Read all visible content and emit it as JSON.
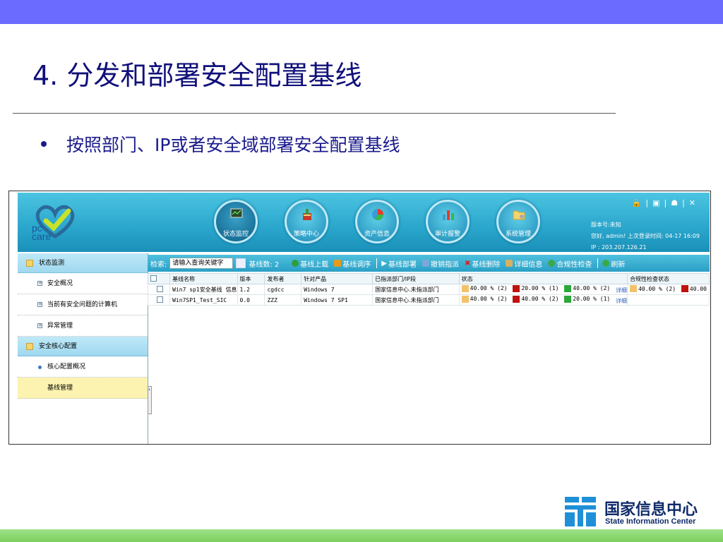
{
  "slide": {
    "title": "4. 分发和部署安全配置基线",
    "bullet": "按照部门、IP或者安全域部署安全配置基线"
  },
  "app": {
    "logo_text": "pc\ncare",
    "nav": [
      {
        "label": "状态监控",
        "icon": "monitor-icon",
        "active": true
      },
      {
        "label": "策略中心",
        "icon": "policy-icon",
        "active": false
      },
      {
        "label": "资产信息",
        "icon": "pie-chart-icon",
        "active": false
      },
      {
        "label": "审计报警",
        "icon": "bar-chart-icon",
        "active": false
      },
      {
        "label": "系统管理",
        "icon": "folder-gear-icon",
        "active": false
      }
    ],
    "header_info": {
      "version": "版本号:未知",
      "greeting": "您好, admin! 上次登录时间: 04-17 16:09",
      "ip": "IP : 203.207.126.21"
    },
    "sidebar": {
      "groups": [
        {
          "label": "状态监测",
          "items": [
            {
              "label": "安全概况",
              "type": "expand"
            },
            {
              "label": "当前有安全问题的计算机",
              "type": "expand"
            },
            {
              "label": "异常管理",
              "type": "expand"
            }
          ]
        },
        {
          "label": "安全核心配置",
          "items": [
            {
              "label": "核心配置概况",
              "type": "dot"
            },
            {
              "label": "基线管理",
              "type": "selected"
            }
          ]
        }
      ]
    },
    "toolbar": {
      "search_label": "检索:",
      "search_placeholder": "请输入查询关键字",
      "count_label": "基线数: 2",
      "actions": [
        {
          "label": "基线上载",
          "color": "#2e9d3a"
        },
        {
          "label": "基线调序",
          "color": "#e89a1a"
        },
        {
          "label": "基线部署",
          "color": "#ffffff"
        },
        {
          "label": "撤销指派",
          "color": "#7aa8d8"
        },
        {
          "label": "基线删除",
          "color": "#d82020"
        },
        {
          "label": "详细信息",
          "color": "#d8b060"
        },
        {
          "label": "合规性检查",
          "color": "#3aa84a"
        },
        {
          "label": "刷新",
          "color": "#3aa84a"
        }
      ]
    },
    "table": {
      "columns": [
        "",
        "基线名称",
        "版本",
        "发布者",
        "针对产品",
        "已指派部门/IP段",
        "状态",
        "合规性检查状态"
      ],
      "rows": [
        {
          "name": "Win7 sp1安全基线 信息",
          "version": "1.2",
          "publisher": "cgdcc",
          "product": "Windows 7",
          "assigned": "国家信息中心.未指派部门",
          "status": [
            "40.00 % (2)",
            "20.00 % (1)",
            "40.00 % (2)"
          ],
          "detail": "详细",
          "compliance": [
            "40.00 % (2)",
            "40.00"
          ]
        },
        {
          "name": "Win7SP1_Test_SIC",
          "version": "0.0",
          "publisher": "ZZZ",
          "product": "Windows 7 SP1",
          "assigned": "国家信息中心.未指派部门",
          "status": [
            "40.00 % (2)",
            "40.00 % (2)",
            "20.00 % (1)"
          ],
          "detail": "详细",
          "compliance": []
        }
      ],
      "status_colors": [
        "#f2c26a",
        "#c01010",
        "#2aa83a"
      ]
    }
  },
  "footer": {
    "org_cn": "国家信息中心",
    "org_en": "State Information Center"
  }
}
